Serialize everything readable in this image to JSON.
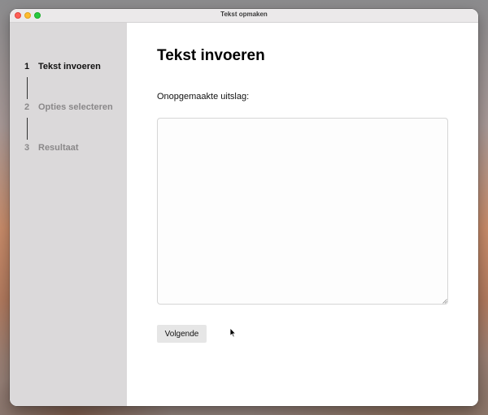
{
  "window": {
    "title": "Tekst opmaken"
  },
  "steps": [
    {
      "number": "1",
      "label": "Tekst invoeren",
      "active": true
    },
    {
      "number": "2",
      "label": "Opties selecteren",
      "active": false
    },
    {
      "number": "3",
      "label": "Resultaat",
      "active": false
    }
  ],
  "main": {
    "title": "Tekst invoeren",
    "input_label": "Onopgemaakte uitslag:",
    "input_value": "",
    "next_label": "Volgende"
  },
  "colors": {
    "sidebar_bg": "#dbd9da",
    "active_step": "#111111",
    "inactive_step": "#8a8889",
    "button_bg": "#e6e6e6"
  }
}
